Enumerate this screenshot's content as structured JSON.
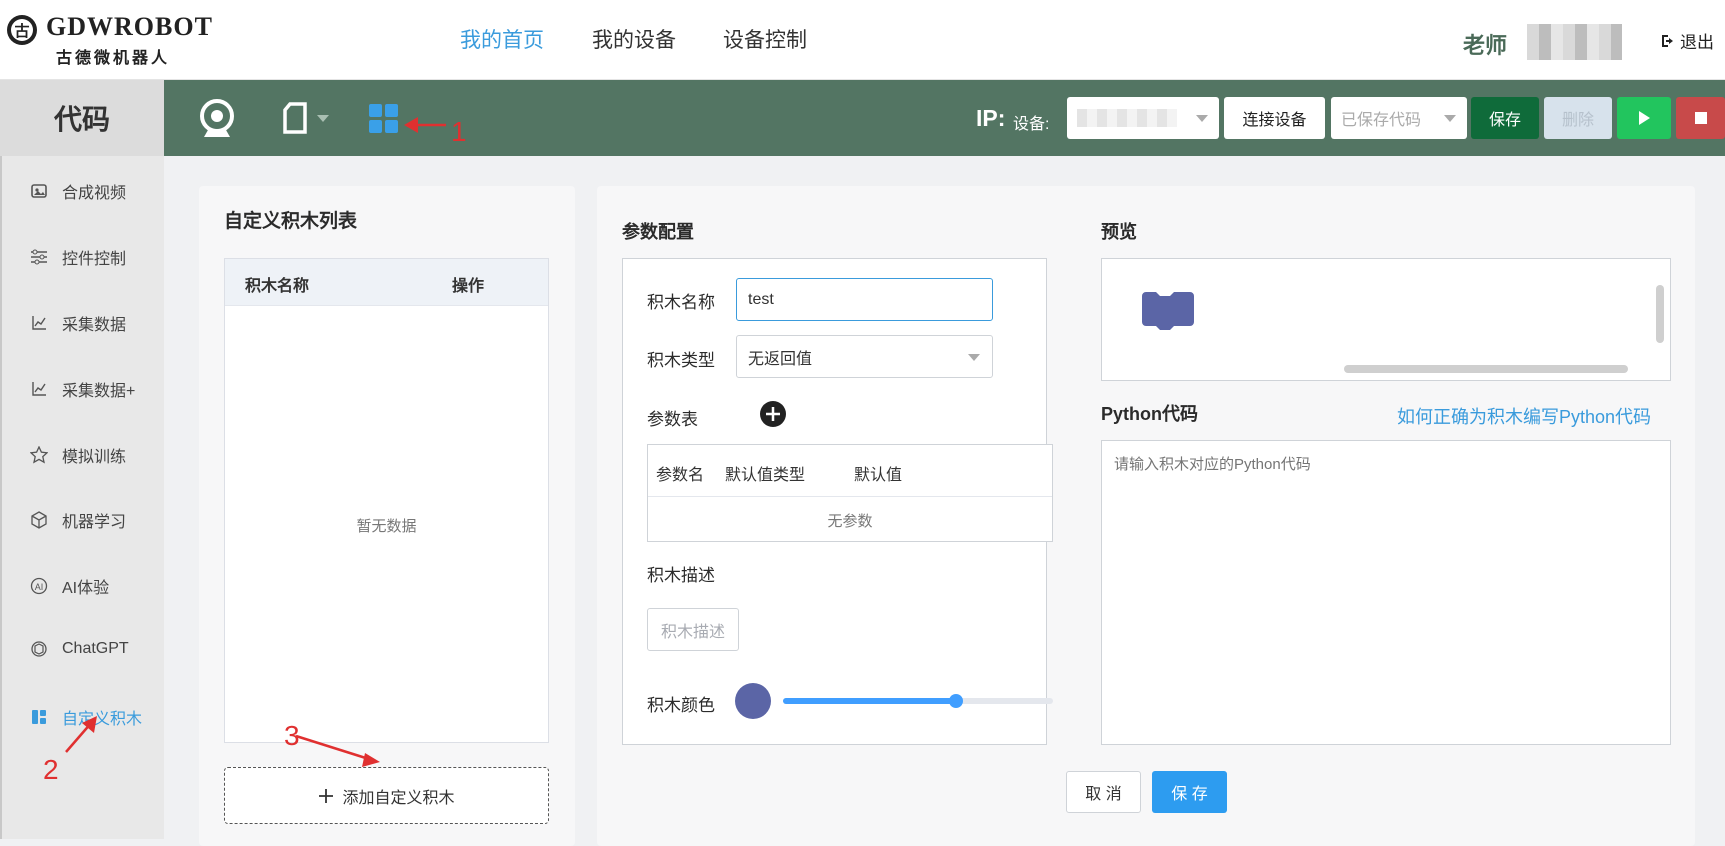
{
  "header": {
    "logo_text": "GDWROBOT",
    "logo_sub": "古德微机器人",
    "nav": [
      {
        "label": "我的首页",
        "active": true
      },
      {
        "label": "我的设备",
        "active": false
      },
      {
        "label": "设备控制",
        "active": false
      }
    ],
    "user_role": "老师",
    "logout_label": "退出"
  },
  "sidebar": {
    "title": "代码",
    "items": [
      {
        "label": "合成视频",
        "icon": "image-icon"
      },
      {
        "label": "控件控制",
        "icon": "sliders-icon"
      },
      {
        "label": "采集数据",
        "icon": "chart-icon"
      },
      {
        "label": "采集数据+",
        "icon": "chart-icon"
      },
      {
        "label": "模拟训练",
        "icon": "star-icon"
      },
      {
        "label": "机器学习",
        "icon": "cube-icon"
      },
      {
        "label": "AI体验",
        "icon": "ai-icon"
      },
      {
        "label": "ChatGPT",
        "icon": "openai-icon"
      },
      {
        "label": "自定义积木",
        "icon": "blocks-icon",
        "active": true
      }
    ]
  },
  "toolbar": {
    "ip_label": "IP:",
    "device_label": "设备:",
    "connect_label": "连接设备",
    "saved_code_placeholder": "已保存代码",
    "save_label": "保存",
    "delete_label": "删除"
  },
  "block_list": {
    "title": "自定义积木列表",
    "columns": [
      "积木名称",
      "操作"
    ],
    "empty_text": "暂无数据",
    "add_label": "添加自定义积木"
  },
  "config": {
    "title": "参数配置",
    "name_label": "积木名称",
    "name_value": "test",
    "type_label": "积木类型",
    "type_value": "无返回值",
    "params_label": "参数表",
    "param_columns": [
      "参数名",
      "默认值类型",
      "默认值"
    ],
    "no_params": "无参数",
    "desc_label": "积木描述",
    "desc_button": "积木描述",
    "color_label": "积木颜色",
    "color_value": "#5b65a6",
    "slider_value": 0.64
  },
  "preview": {
    "title": "预览",
    "python_title": "Python代码",
    "help_link": "如何正确为积木编写Python代码",
    "code_placeholder": "请输入积木对应的Python代码"
  },
  "footer": {
    "cancel_label": "取 消",
    "save_label": "保 存"
  },
  "annotations": [
    "1",
    "2",
    "3"
  ]
}
